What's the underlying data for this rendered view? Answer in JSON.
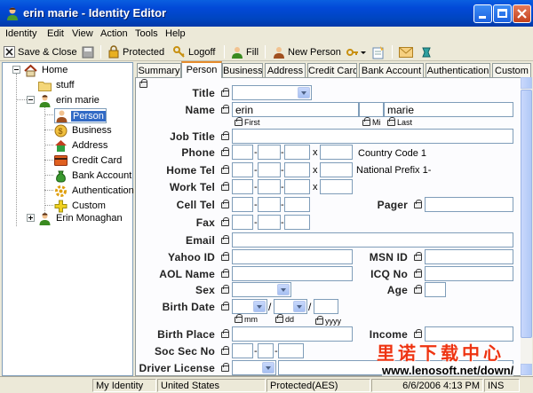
{
  "window": {
    "title": "erin marie - Identity Editor"
  },
  "menu": [
    "Identity",
    "Edit",
    "View",
    "Action",
    "Tools",
    "Help"
  ],
  "toolbar": {
    "save_close": "Save & Close",
    "protected": "Protected",
    "logoff": "Logoff",
    "fill": "Fill",
    "new_person": "New Person"
  },
  "tree": {
    "home": "Home",
    "stuff": "stuff",
    "identity": "erin marie",
    "items": [
      "Person",
      "Business",
      "Address",
      "Credit Card",
      "Bank Account",
      "Authentication",
      "Custom"
    ],
    "other": "Erin Monaghan"
  },
  "tabs": [
    "Summary",
    "Person",
    "Business",
    "Address",
    "Credit Card",
    "Bank Account",
    "Authentication",
    "Custom"
  ],
  "form": {
    "title_label": "Title",
    "name_label": "Name",
    "first_value": "erin",
    "last_value": "marie",
    "first_sub": "First",
    "mi_sub": "Mi",
    "last_sub": "Last",
    "job_title_label": "Job Title",
    "phone_label": "Phone",
    "home_tel_label": "Home Tel",
    "work_tel_label": "Work Tel",
    "cell_tel_label": "Cell Tel",
    "fax_label": "Fax",
    "country_code_text": "Country Code 1",
    "national_prefix_text": "National Prefix 1-",
    "pager_label": "Pager",
    "email_label": "Email",
    "yahoo_label": "Yahoo ID",
    "msn_label": "MSN ID",
    "aol_label": "AOL Name",
    "icq_label": "ICQ No",
    "sex_label": "Sex",
    "age_label": "Age",
    "birth_date_label": "Birth Date",
    "mm_sub": "mm",
    "dd_sub": "dd",
    "yyyy_sub": "yyyy",
    "birth_place_label": "Birth Place",
    "income_label": "Income",
    "ssn_label": "Soc Sec No",
    "dl_label": "Driver License",
    "x_char": "x",
    "dash": "-",
    "slash": "/"
  },
  "status": {
    "identity": "My Identity",
    "country": "United States",
    "protection": "Protected(AES)",
    "datetime": "6/6/2006 4:13 PM",
    "mode": "INS"
  },
  "watermark": {
    "cn": "里诺下载中心",
    "url": "www.lenosoft.net/down/"
  }
}
